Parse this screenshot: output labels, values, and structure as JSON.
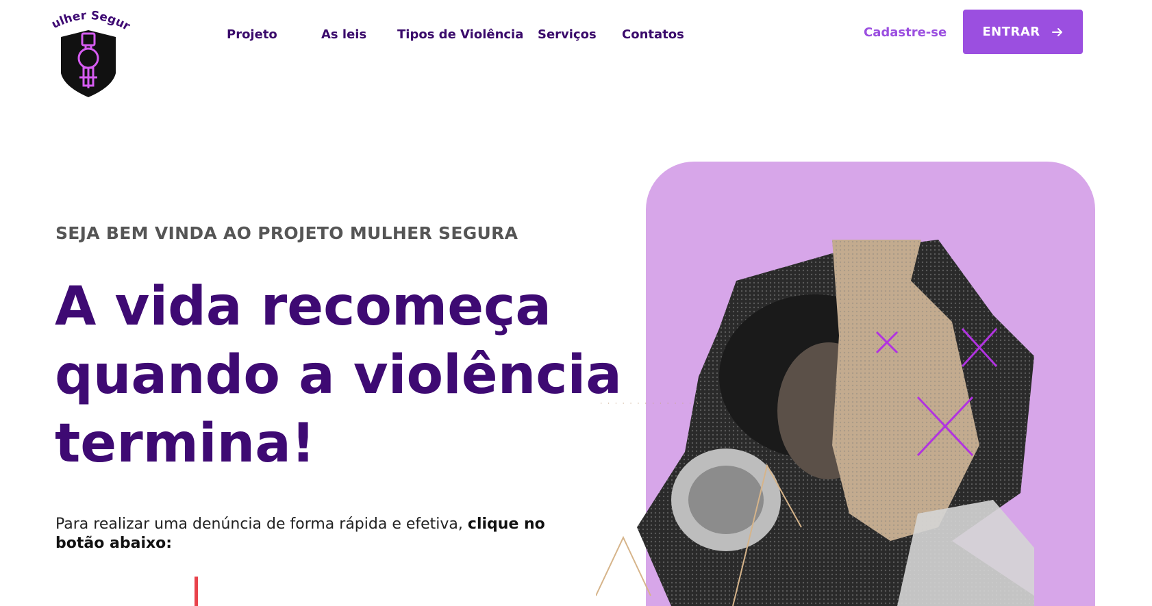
{
  "brand": {
    "name": "Mulher Segura",
    "colors": {
      "primary": "#9b4fe0",
      "dark": "#3e0a73",
      "card": "#d7a6e9",
      "accent_red": "#e8424b"
    }
  },
  "nav": {
    "items": [
      {
        "label": "Projeto"
      },
      {
        "label": "As leis"
      },
      {
        "label": "Tipos de Violência"
      },
      {
        "label": "Serviços"
      },
      {
        "label": "Contatos"
      }
    ],
    "signup_label": "Cadastre-se",
    "login_label": "ENTRAR",
    "login_icon": "arrow-right-icon"
  },
  "hero": {
    "kicker": "SEJA BEM VINDA AO PROJETO MULHER SEGURA",
    "headline_lines": [
      "A vida recomeça",
      "quando a violência",
      "termina!"
    ],
    "lead_text": "Para realizar uma denúncia de forma rápida e efetiva,",
    "lead_bold": "clique no botão abaixo:"
  }
}
